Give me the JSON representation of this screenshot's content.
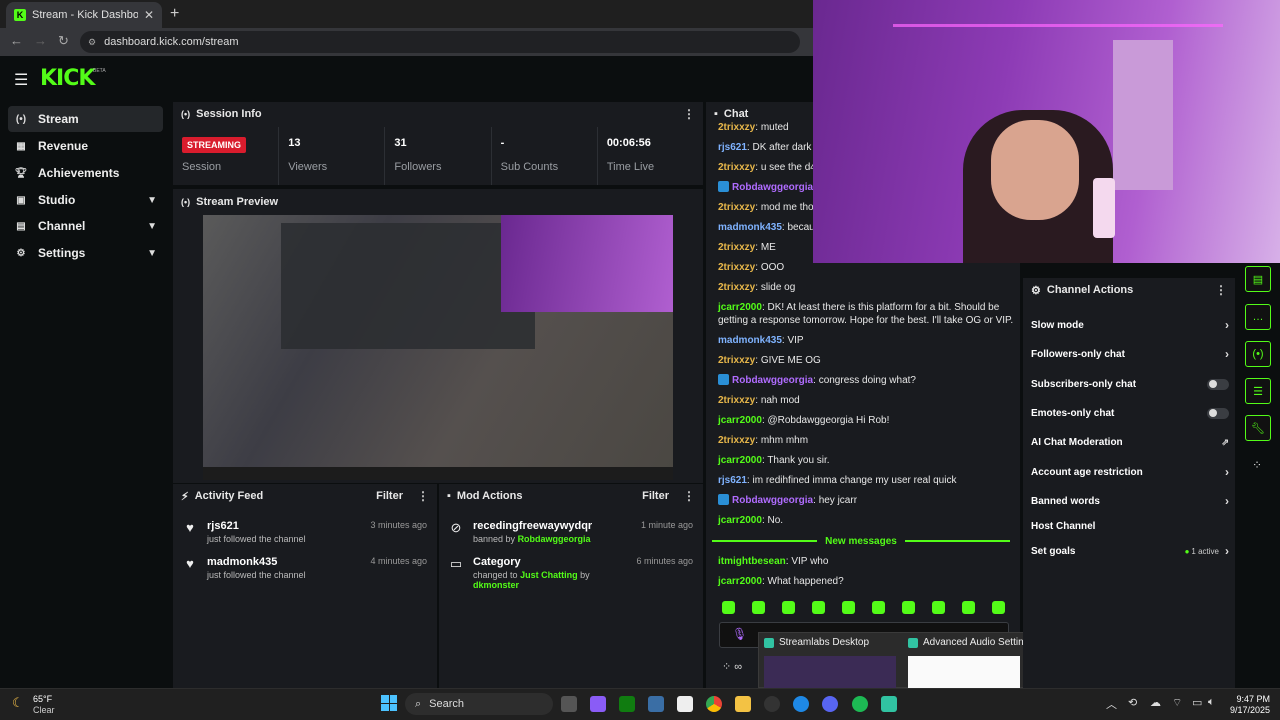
{
  "browser": {
    "tab_title": "Stream - Kick Dashboard",
    "url": "dashboard.kick.com/stream"
  },
  "brand": {
    "logo": "KICK",
    "beta": "BETA",
    "accent": "#53fc18"
  },
  "sidebar": {
    "items": [
      {
        "label": "Stream",
        "icon": "broadcast-icon",
        "active": true
      },
      {
        "label": "Revenue",
        "icon": "revenue-icon"
      },
      {
        "label": "Achievements",
        "icon": "trophy-icon"
      },
      {
        "label": "Studio",
        "icon": "studio-icon",
        "expandable": true
      },
      {
        "label": "Channel",
        "icon": "channel-icon",
        "expandable": true
      },
      {
        "label": "Settings",
        "icon": "gear-icon",
        "expandable": true
      }
    ]
  },
  "session_info": {
    "title": "Session Info",
    "status_badge": "STREAMING",
    "status_label": "Session",
    "stats": [
      {
        "value": "13",
        "label": "Viewers"
      },
      {
        "value": "31",
        "label": "Followers"
      },
      {
        "value": "-",
        "label": "Sub Counts"
      },
      {
        "value": "00:06:56",
        "label": "Time Live"
      }
    ]
  },
  "stream_preview": {
    "title": "Stream Preview"
  },
  "activity_feed": {
    "title": "Activity Feed",
    "filter": "Filter",
    "items": [
      {
        "name": "rjs621",
        "desc": "just followed the channel",
        "time": "3 minutes ago"
      },
      {
        "name": "madmonk435",
        "desc": "just followed the channel",
        "time": "4 minutes ago"
      }
    ]
  },
  "mod_actions": {
    "title": "Mod Actions",
    "filter": "Filter",
    "items": [
      {
        "name": "recedingfreewaywydqr",
        "prefix": "banned by",
        "actor": "Robdawggeorgia",
        "time": "1 minute ago"
      },
      {
        "name": "Category",
        "prefix": "changed to",
        "actor": "Just Chatting",
        "by": "by",
        "actor2": "dkmonster",
        "time": "6 minutes ago"
      }
    ]
  },
  "chat": {
    "title": "Chat",
    "messages": [
      {
        "user": "2trixxzy",
        "text": "muted"
      },
      {
        "user": "rjs621",
        "text": "DK after dark"
      },
      {
        "user": "2trixxzy",
        "text": "u see the d4v"
      },
      {
        "user": "Robdawggeorgia",
        "text": "v"
      },
      {
        "user": "2trixxzy",
        "text": "mod me thoo"
      },
      {
        "user": "madmonk435",
        "text": "becaus"
      },
      {
        "user": "2trixxzy",
        "text": "ME"
      },
      {
        "user": "2trixxzy",
        "text": "OOO"
      },
      {
        "user": "2trixxzy",
        "text": "slide og"
      },
      {
        "user": "jcarr2000",
        "text": "DK! At least there is this platform for a bit. Should be getting a response tomorrow. Hope for the best. I'll take OG or VIP."
      },
      {
        "user": "madmonk435",
        "text": "VIP"
      },
      {
        "user": "2trixxzy",
        "text": "GIVE ME OG"
      },
      {
        "user": "Robdawggeorgia",
        "text": "congress doing what?"
      },
      {
        "user": "2trixxzy",
        "text": "nah mod"
      },
      {
        "user": "jcarr2000",
        "text": "@Robdawggeorgia Hi Rob!"
      },
      {
        "user": "2trixxzy",
        "text": "mhm mhm"
      },
      {
        "user": "jcarr2000",
        "text": "Thank you sir."
      },
      {
        "user": "rjs621",
        "text": "im redihfined imma change my user real quick"
      },
      {
        "user": "Robdawggeorgia",
        "text": "hey jcarr"
      },
      {
        "user": "jcarr2000",
        "text": "No."
      }
    ],
    "new_messages_label": "New messages",
    "new_messages": [
      {
        "user": "itmightbesean",
        "text": "VIP who"
      },
      {
        "user": "jcarr2000",
        "text": "What happened?"
      }
    ]
  },
  "channel_actions": {
    "title": "Channel Actions",
    "items": [
      {
        "label": "Slow mode",
        "control": "chevron"
      },
      {
        "label": "Followers-only chat",
        "control": "chevron"
      },
      {
        "label": "Subscribers-only chat",
        "control": "toggle"
      },
      {
        "label": "Emotes-only chat",
        "control": "toggle"
      },
      {
        "label": "AI Chat Moderation",
        "control": "external"
      },
      {
        "label": "Account age restriction",
        "control": "chevron"
      },
      {
        "label": "Banned words",
        "control": "chevron"
      },
      {
        "label": "Host Channel",
        "control": "none"
      },
      {
        "label": "Set goals",
        "control": "chevron",
        "badge": "1 active"
      }
    ]
  },
  "taskbar": {
    "weather_temp": "65°F",
    "weather_cond": "Clear",
    "search": "Search",
    "time": "9:47 PM",
    "date": "9/17/2025",
    "popup": [
      {
        "title": "Streamlabs Desktop"
      },
      {
        "title": "Advanced Audio Settin..."
      }
    ]
  }
}
